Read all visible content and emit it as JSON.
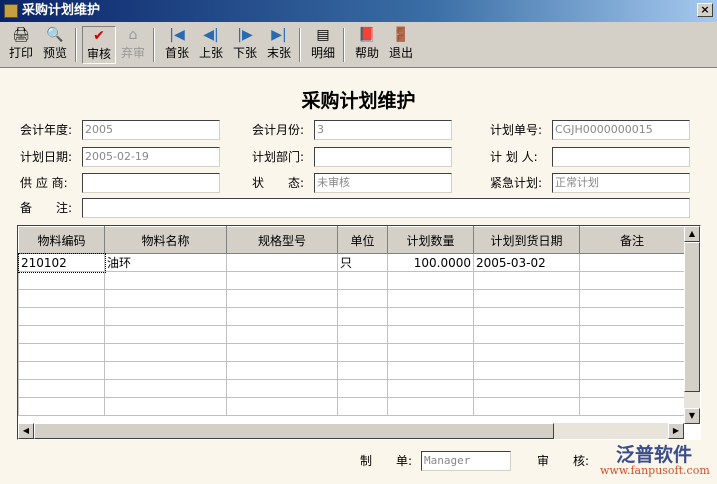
{
  "window": {
    "title": "采购计划维护",
    "close": "×"
  },
  "toolbar": [
    {
      "label": "打印",
      "icon": "printer-icon",
      "glyph": "🖨",
      "state": "normal"
    },
    {
      "label": "预览",
      "icon": "preview-icon",
      "glyph": "🔍",
      "state": "normal"
    },
    {
      "label": "审核",
      "icon": "check-icon",
      "glyph": "✔",
      "state": "pressed"
    },
    {
      "label": "弃审",
      "icon": "abandon-audit-icon",
      "glyph": "⌂",
      "state": "disabled"
    },
    {
      "label": "首张",
      "icon": "first-icon",
      "glyph": "|◀",
      "state": "normal"
    },
    {
      "label": "上张",
      "icon": "previous-icon",
      "glyph": "◀|",
      "state": "normal"
    },
    {
      "label": "下张",
      "icon": "next-icon",
      "glyph": "|▶",
      "state": "normal"
    },
    {
      "label": "末张",
      "icon": "last-icon",
      "glyph": "▶|",
      "state": "normal"
    },
    {
      "label": "明细",
      "icon": "detail-icon",
      "glyph": "▤",
      "state": "normal"
    },
    {
      "label": "帮助",
      "icon": "help-book-icon",
      "glyph": "📕",
      "state": "normal"
    },
    {
      "label": "退出",
      "icon": "exit-door-icon",
      "glyph": "🚪",
      "state": "normal"
    }
  ],
  "page_title": "采购计划维护",
  "form": {
    "fiscal_year": {
      "label": "会计年度:",
      "value": "2005"
    },
    "fiscal_month": {
      "label": "会计月份:",
      "value": "3"
    },
    "plan_no": {
      "label": "计划单号:",
      "value": "CGJH0000000015"
    },
    "plan_date": {
      "label": "计划日期:",
      "value": "2005-02-19"
    },
    "plan_dept": {
      "label": "计划部门:",
      "value": ""
    },
    "planner": {
      "label": "计 划 人:",
      "value": ""
    },
    "supplier": {
      "label": "供 应 商:",
      "value": ""
    },
    "status": {
      "label": "状　　态:",
      "value": "未审核"
    },
    "urgent": {
      "label": "紧急计划:",
      "value": "正常计划"
    },
    "remark": {
      "label": "备　　注:",
      "value": ""
    }
  },
  "table": {
    "columns": [
      "物料编码",
      "物料名称",
      "规格型号",
      "单位",
      "计划数量",
      "计划到货日期",
      "备注"
    ],
    "rows": [
      [
        "210102",
        "油环",
        "",
        "只",
        "100.0000",
        "2005-03-02",
        ""
      ]
    ]
  },
  "footer": {
    "maker_label": "制　　单:",
    "maker": "Manager",
    "auditor_label": "审　　核:"
  },
  "logo": {
    "name": "泛普软件",
    "url": "www.fanpusoft.com"
  }
}
